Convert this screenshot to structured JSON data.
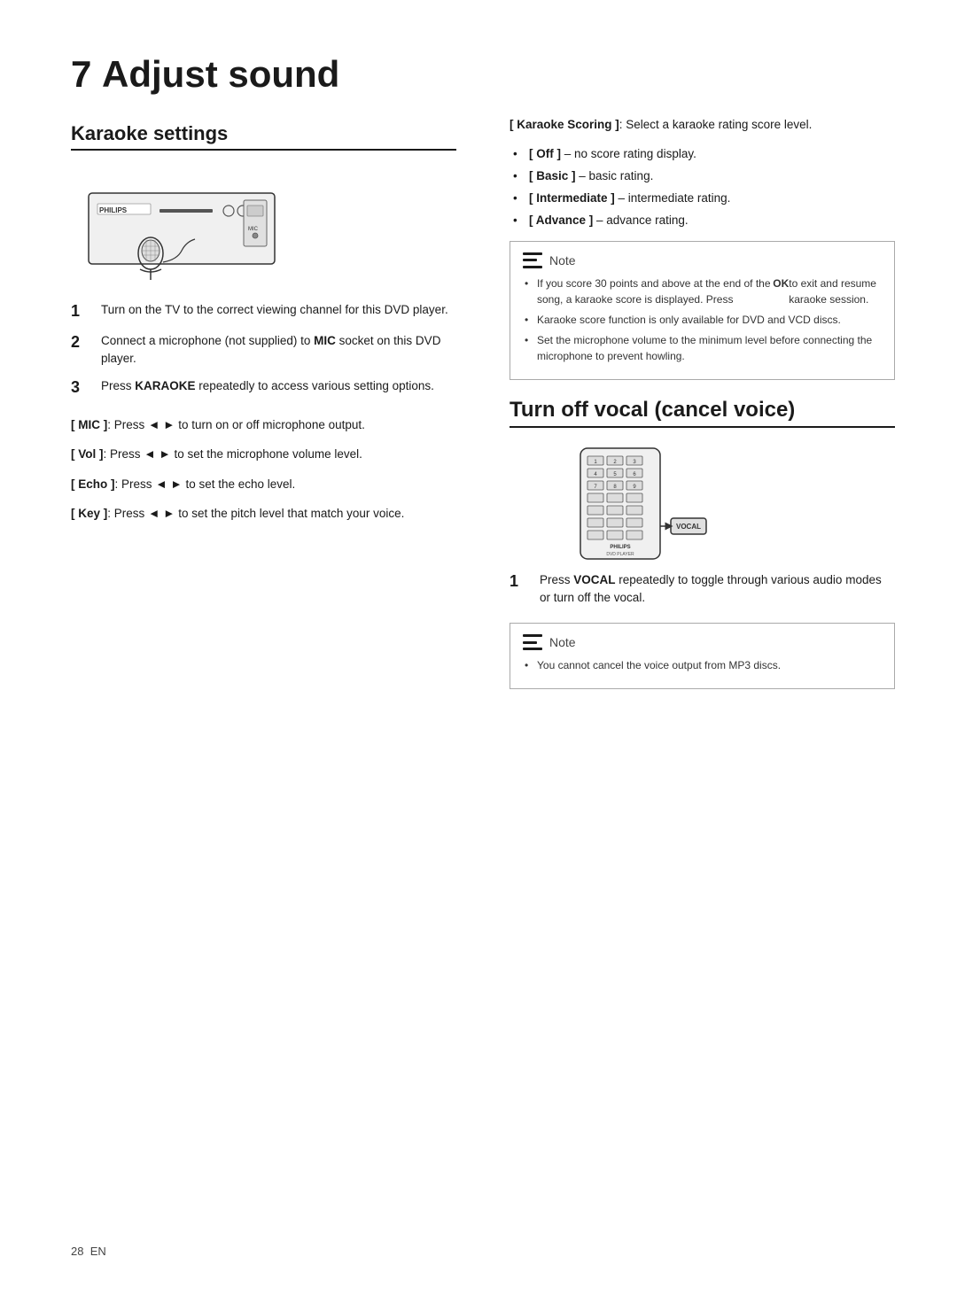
{
  "page": {
    "footer": {
      "page_number": "28",
      "lang": "EN"
    }
  },
  "chapter": {
    "number": "7",
    "title": "Adjust sound"
  },
  "karaoke_section": {
    "title": "Karaoke settings",
    "steps": [
      {
        "num": "1",
        "text": "Turn on the TV to the correct viewing channel for this DVD player."
      },
      {
        "num": "2",
        "text": "Connect a microphone (not supplied) to MIC socket on this DVD player."
      },
      {
        "num": "3",
        "text": "Press KARAOKE repeatedly to access various setting options."
      }
    ],
    "params": [
      {
        "label": "[ MIC ]",
        "desc": ": Press ◄ ► to turn on or off microphone output."
      },
      {
        "label": "[ Vol ]",
        "desc": ": Press ◄ ► to set the microphone volume level."
      },
      {
        "label": "[ Echo ]",
        "desc": ": Press ◄ ► to set the echo level."
      },
      {
        "label": "[ Key ]",
        "desc": ": Press ◄ ► to set the pitch level that match your voice."
      }
    ]
  },
  "right_col": {
    "karaoke_scoring": {
      "intro": "[ Karaoke Scoring ]: Select a karaoke rating score level.",
      "options": [
        {
          "label": "[ Off ]",
          "desc": "– no score rating display."
        },
        {
          "label": "[ Basic ]",
          "desc": "– basic rating."
        },
        {
          "label": "[ Intermediate ]",
          "desc": "– intermediate rating."
        },
        {
          "label": "[ Advance ]",
          "desc": "– advance rating."
        }
      ]
    },
    "note1": {
      "label": "Note",
      "items": [
        "If you score 30 points and above at the end of the song, a karaoke score is displayed. Press OK to exit and resume karaoke session.",
        "Karaoke score function is only available for DVD and VCD discs.",
        "Set the microphone volume to the minimum level before connecting the microphone to prevent howling."
      ]
    },
    "turn_off_section": {
      "title": "Turn off vocal (cancel voice)",
      "step1": {
        "num": "1",
        "text": "Press VOCAL repeatedly to toggle through various audio modes or turn off the vocal."
      }
    },
    "note2": {
      "label": "Note",
      "items": [
        "You cannot cancel the voice output from MP3 discs."
      ]
    }
  }
}
